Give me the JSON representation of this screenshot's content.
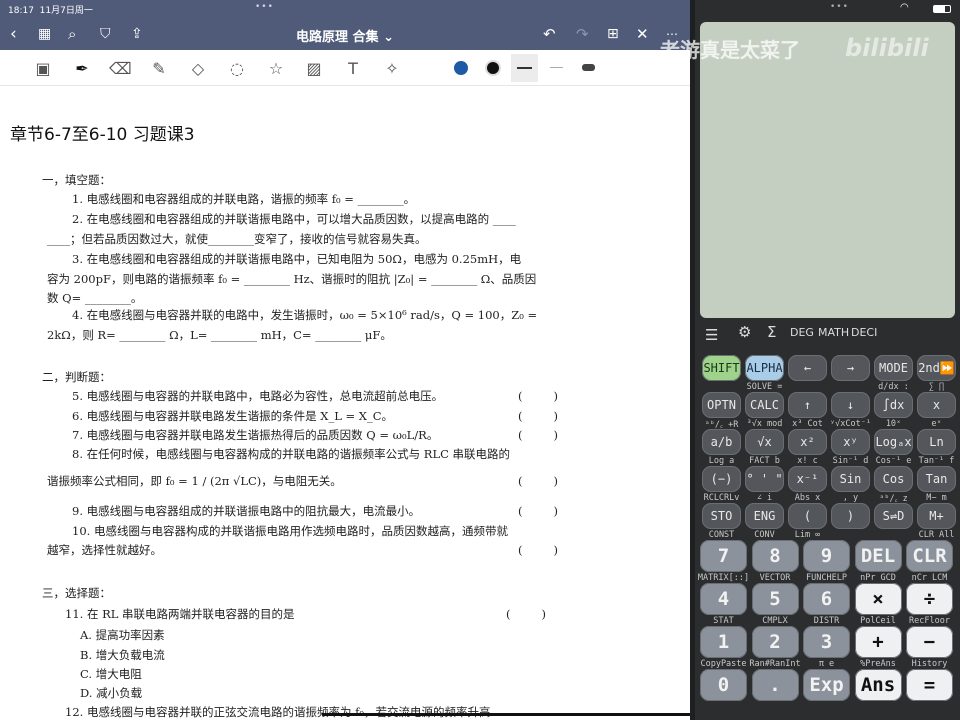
{
  "status": {
    "time": "18:17",
    "date": "11月7日周一"
  },
  "header": {
    "title": "电路原理 合集 ⌄"
  },
  "colors": {
    "accent_blue": "#1f5aa6",
    "pen_black": "#111111",
    "topbar": "#4f5b78"
  },
  "doc": {
    "chapter": "章节6-7至6-10   习题课3",
    "lines": [
      "一，填空题：",
      "1. 电感线圈和电容器组成的并联电路，谐振的频率 f₀ = ________。",
      "2. 在电感线圈和电容器组成的并联谐振电路中，可以增大品质因数，以提高电路的 ____",
      "____；但若品质因数过大，就使________变窄了，接收的信号就容易失真。",
      "3. 在电感线圈和电容器组成的并联谐振电路中，已知电阻为 50Ω，电感为 0.25mH，电",
      "容为 200pF，则电路的谐振频率 f₀ = ________ Hz、谐振时的阻抗 |Z₀| = ________ Ω、品质因",
      "数 Q= ________。",
      "4. 在电感线圈与电容器并联的电路中，发生谐振时，ω₀ = 5×10⁶ rad/s，Q = 100，Z₀ =",
      "2kΩ，则 R= ________ Ω，L= ________ mH，C= ________ μF。",
      "二，判断题：",
      "5. 电感线圈与电容器的并联电路中，电路必为容性，总电流超前总电压。",
      "6. 电感线圈与电容器并联电路发生谐振的条件是 X_L = X_C。",
      "7. 电感线圈与电容器并联电路发生谐振热得后的品质因数 Q = ω₀L/R。",
      "8. 在任何时候，电感线圈与电容器构成的并联电路的谐振频率公式与 RLC 串联电路的",
      "谐振频率公式相同，即 f₀ = 1 / (2π √LC)，与电阻无关。",
      "9. 电感线圈与电容器组成的并联谐振电路中的阻抗最大，电流最小。",
      "10. 电感线圈与电容器构成的并联谐振电路用作选频电路时，品质因数越高，通频带就",
      "越窄，选择性就越好。",
      "三，选择题：",
      "11. 在 RL 串联电路两端并联电容器的目的是",
      "A. 提高功率因素",
      "B. 增大负载电流",
      "C. 增大电阻",
      "D. 减小负载",
      "12. 电感线圈与电容器并联的正弦交流电路的谐振频率为 f₀，若交流电源的频率升高"
    ],
    "paren_open": "(",
    "paren_close": ")"
  },
  "watermark": {
    "text": "老游真是太菜了",
    "logo": "bilibili"
  },
  "calc": {
    "menu": [
      "DEG",
      "MATH",
      "DECI"
    ],
    "upper_rows": [
      {
        "keys": [
          "SHIFT",
          "ALPHA",
          "←",
          "→",
          "MODE",
          "2nd⏩"
        ],
        "subs": [
          "",
          "SOLVE =",
          "",
          "",
          "d/dx :",
          "∑  ∏"
        ]
      },
      {
        "keys": [
          "OPTN",
          "CALC",
          "↑",
          "↓",
          "∫dx",
          "x"
        ],
        "subs": [
          "ᵃᵇ/꜀ +R",
          "³√x mod",
          "x³ Cot",
          "ʸ√xCot⁻¹",
          "10ˣ",
          "eˣ"
        ]
      },
      {
        "keys": [
          "a/b",
          "√x",
          "x²",
          "xʸ",
          "Logₐx",
          "Ln"
        ],
        "subs": [
          "Log  a",
          "FACT b",
          "x!  c",
          "Sin⁻¹ d",
          "Cos⁻¹ e",
          "Tan⁻¹ f"
        ]
      },
      {
        "keys": [
          "(−)",
          "° ' \"",
          "x⁻¹",
          "Sin",
          "Cos",
          "Tan"
        ],
        "subs": [
          "RCLCRLv",
          "∠  i",
          "Abs  x",
          ",   y",
          "ᵃᵇ/꜀  z",
          "M−  m"
        ]
      },
      {
        "keys": [
          "STO",
          "ENG",
          "(",
          ")",
          "S⇌D",
          "M+"
        ],
        "subs": [
          "CONST",
          "CONV",
          "Lim ∞",
          "",
          "",
          "CLR All"
        ]
      }
    ],
    "lower_rows": [
      {
        "keys": [
          "7",
          "8",
          "9",
          "DEL",
          "CLR"
        ],
        "subs": [
          "MATRIX[::]",
          "VECTOR",
          "FUNCHELP",
          "nPr GCD",
          "nCr LCM"
        ]
      },
      {
        "keys": [
          "4",
          "5",
          "6",
          "×",
          "÷"
        ],
        "subs": [
          "STAT",
          "CMPLX",
          "DISTR",
          "PolCeil",
          "RecFloor"
        ]
      },
      {
        "keys": [
          "1",
          "2",
          "3",
          "+",
          "−"
        ],
        "subs": [
          "CopyPaste",
          "Ran#RanInt",
          "π   e",
          "%PreAns",
          "History"
        ]
      },
      {
        "keys": [
          "0",
          ".",
          "Exp",
          "Ans",
          "="
        ],
        "subs": []
      }
    ]
  }
}
